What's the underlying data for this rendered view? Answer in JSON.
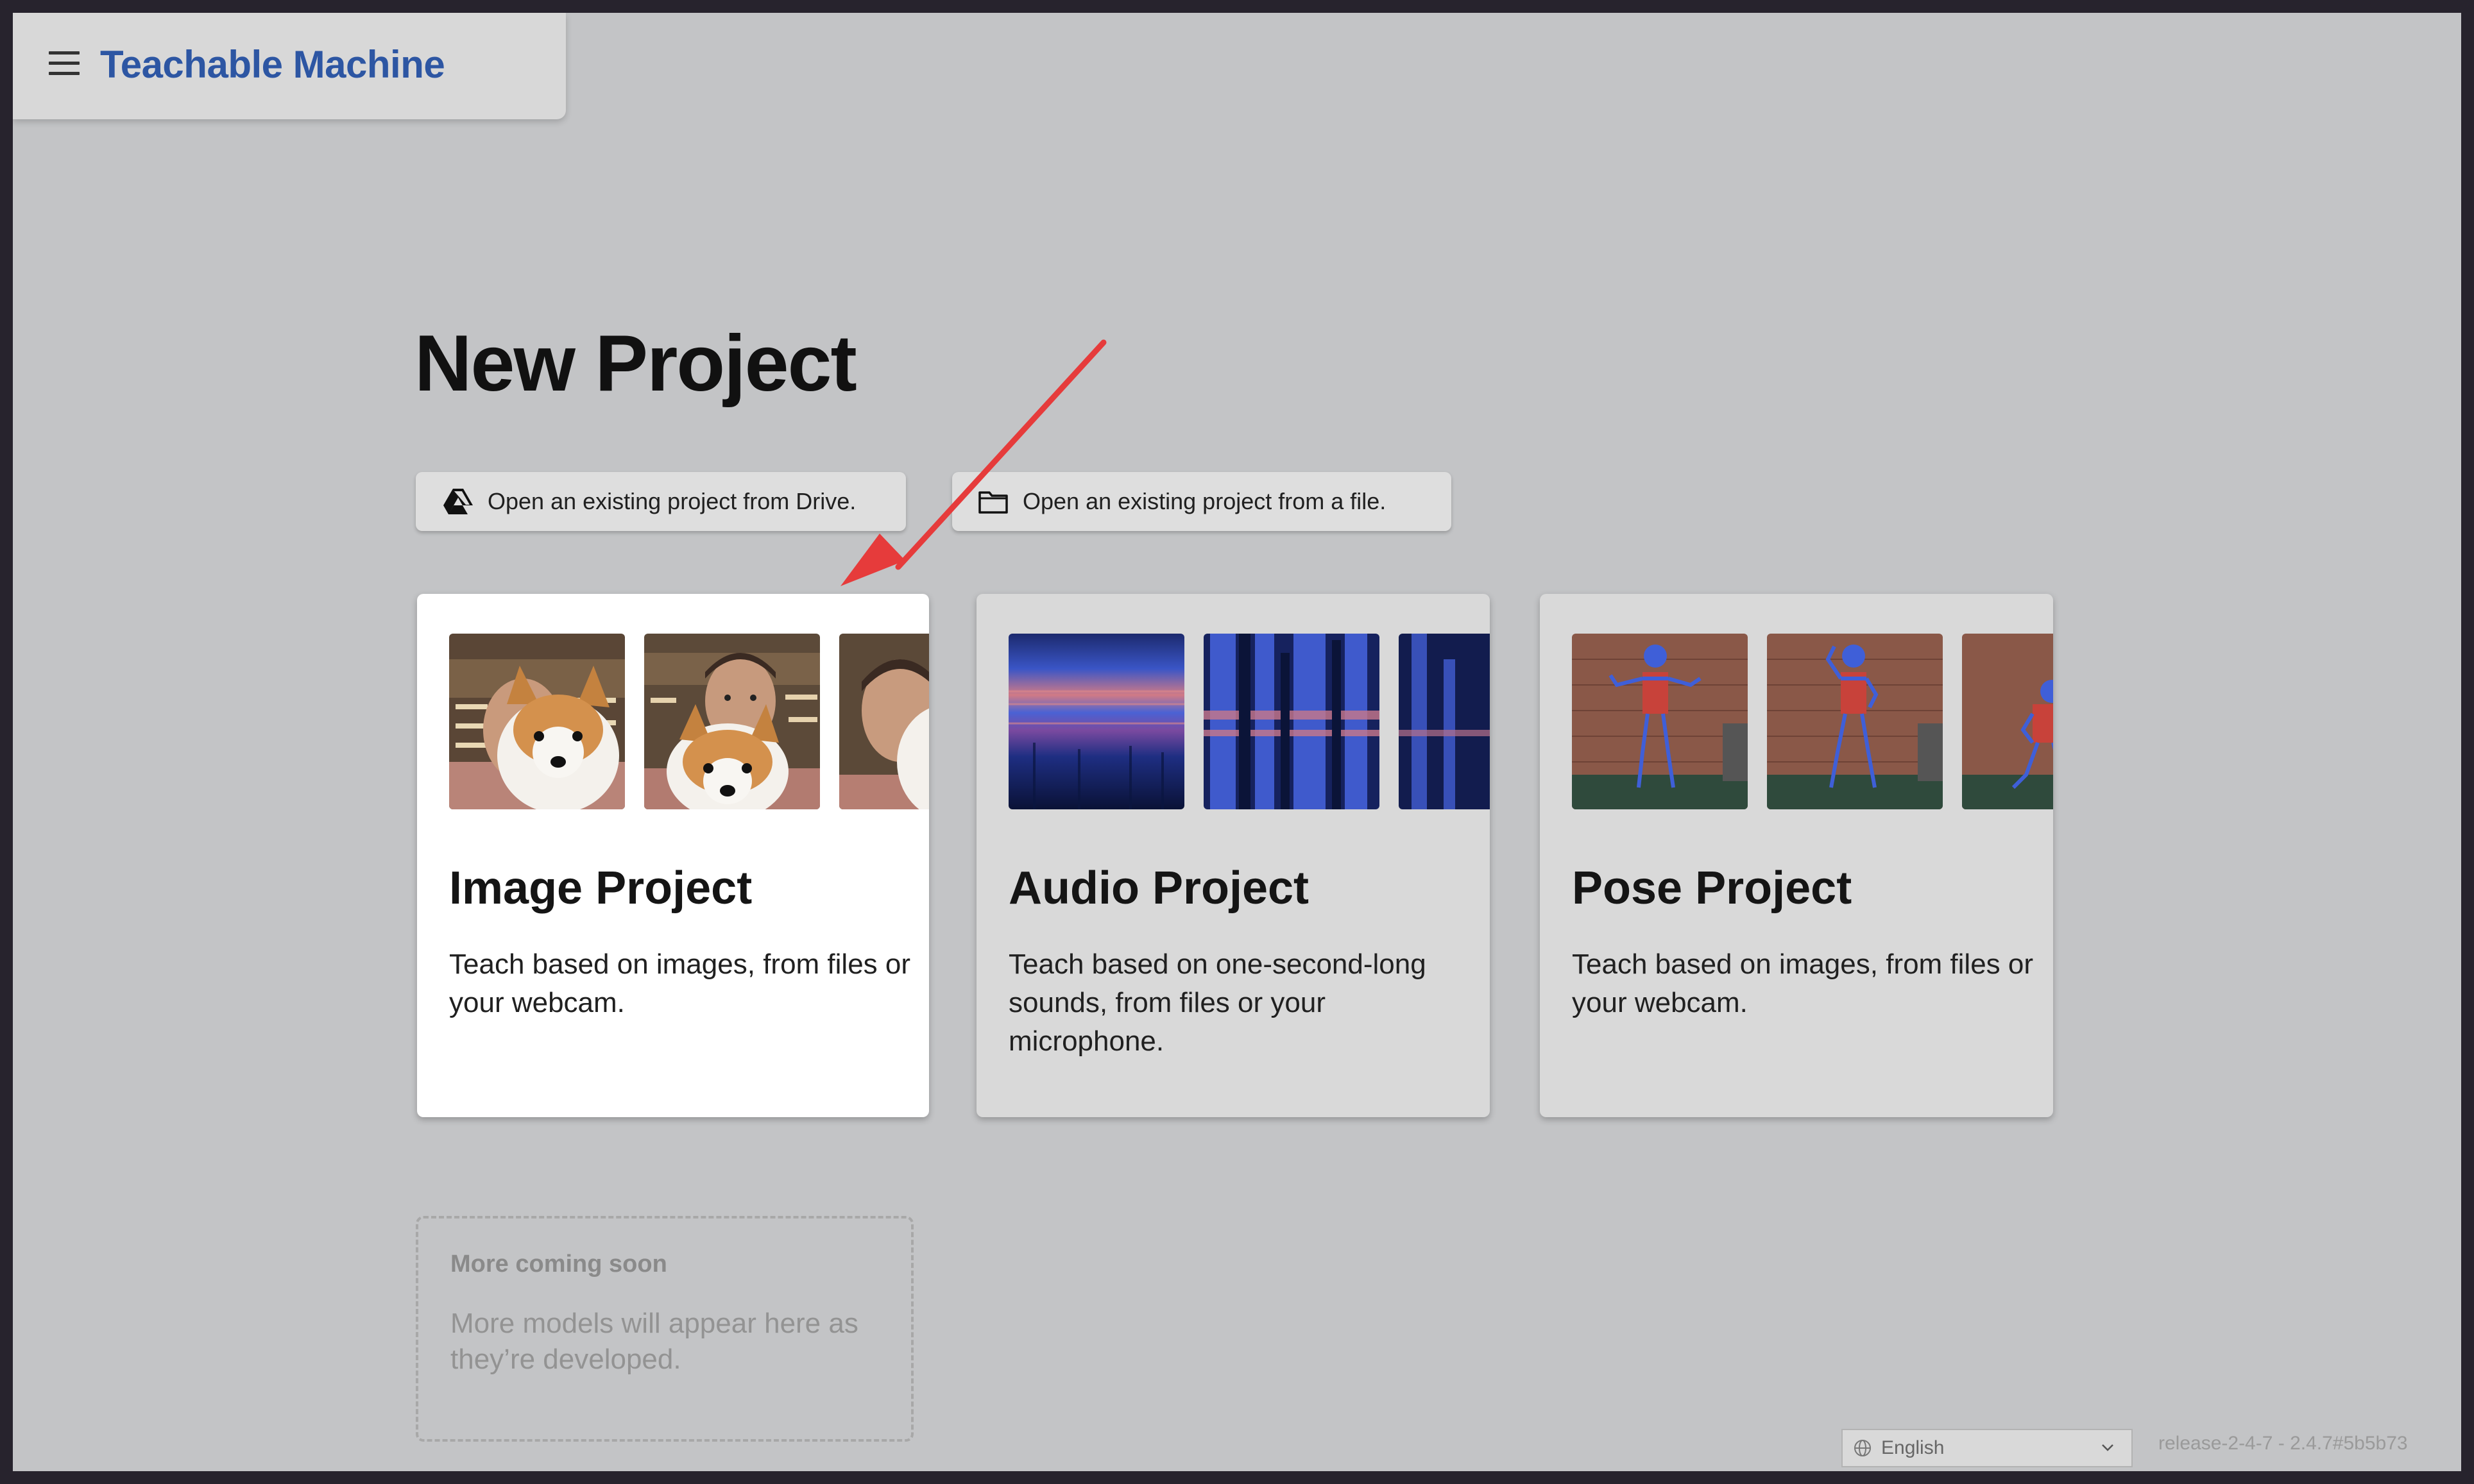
{
  "header": {
    "brand": "Teachable Machine",
    "menu_icon": "hamburger-menu-icon"
  },
  "page": {
    "title": "New Project"
  },
  "open_buttons": {
    "drive": {
      "label": "Open an existing project from Drive.",
      "icon": "google-drive-icon"
    },
    "file": {
      "label": "Open an existing project from a file.",
      "icon": "folder-icon"
    }
  },
  "cards": {
    "image": {
      "title": "Image Project",
      "description": "Teach based on images, from files or your webcam."
    },
    "audio": {
      "title": "Audio Project",
      "description": "Teach based on one-second-long sounds, from files or your microphone."
    },
    "pose": {
      "title": "Pose Project",
      "description": "Teach based on images, from files or your webcam."
    }
  },
  "coming_soon": {
    "title": "More coming soon",
    "description": "More models will appear here as they’re developed."
  },
  "footer": {
    "language": "English",
    "release": "release-2-4-7 - 2.4.7#5b5b73"
  },
  "colors": {
    "brand": "#2d56a3",
    "annotation_arrow": "#e63b3b",
    "screen_bg": "#c3c4c6"
  }
}
